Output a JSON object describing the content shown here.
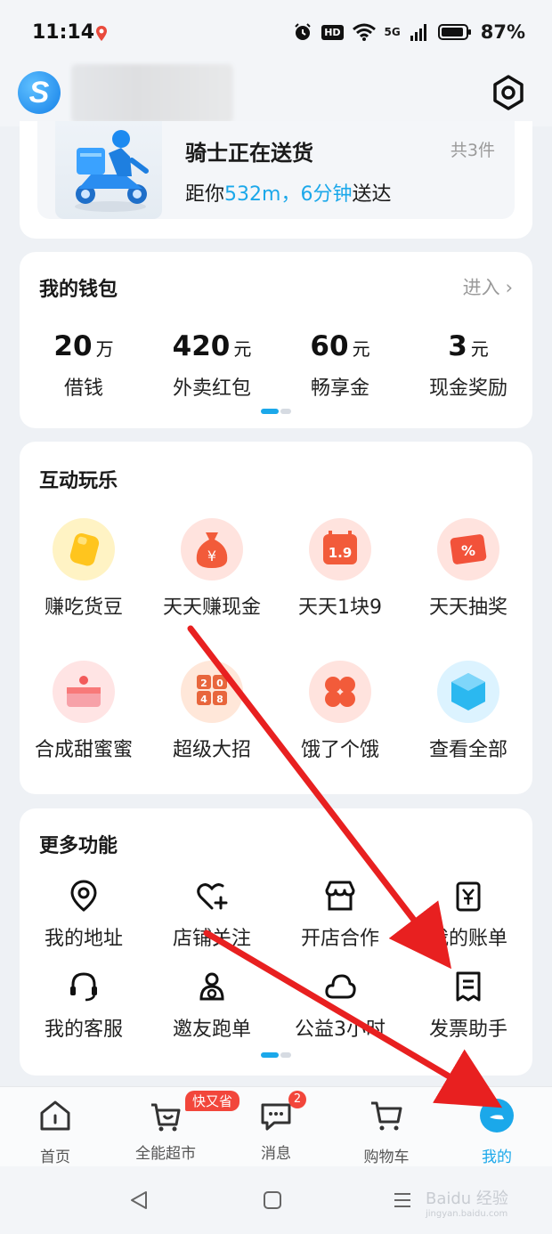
{
  "status_bar": {
    "time": "11:14",
    "battery": "87%",
    "network": "5G",
    "hd": "HD"
  },
  "header": {
    "logo_icon": "app-logo-s",
    "settings_icon": "gear-hex-icon"
  },
  "delivery": {
    "title": "骑士正在送货",
    "count": "共3件",
    "eta_prefix": "距你",
    "eta_distance": "532m，",
    "eta_time": "6分钟",
    "eta_suffix": "送达",
    "accent": "#1ba8ea"
  },
  "wallet": {
    "title": "我的钱包",
    "enter": "进入",
    "items": [
      {
        "value": "20",
        "unit": "万",
        "label": "借钱"
      },
      {
        "value": "420",
        "unit": "元",
        "label": "外卖红包"
      },
      {
        "value": "60",
        "unit": "元",
        "label": "畅享金"
      },
      {
        "value": "3",
        "unit": "元",
        "label": "现金奖励"
      }
    ]
  },
  "play": {
    "title": "互动玩乐",
    "items": [
      {
        "label": "赚吃货豆",
        "icon": "bean-icon",
        "bg": "#fff3c4",
        "color": "#ffc51e"
      },
      {
        "label": "天天赚现金",
        "icon": "money-bag-icon",
        "bg": "#ffe3de",
        "color": "#f25b3a"
      },
      {
        "label": "天天1块9",
        "icon": "calendar-1-9-icon",
        "bg": "#ffe3de",
        "color": "#f25b3a"
      },
      {
        "label": "天天抽奖",
        "icon": "coupon-percent-icon",
        "bg": "#ffe3de",
        "color": "#f2523a"
      },
      {
        "label": "合成甜蜜蜜",
        "icon": "cake-icon",
        "bg": "#ffe4e4",
        "color": "#f87979"
      },
      {
        "label": "超级大招",
        "icon": "2048-tiles-icon",
        "bg": "#ffe7d9",
        "color": "#e8663c"
      },
      {
        "label": "饿了个饿",
        "icon": "clover-icon",
        "bg": "#ffe3de",
        "color": "#f25b3a"
      },
      {
        "label": "查看全部",
        "icon": "cube-icon",
        "bg": "#dcf3ff",
        "color": "#2bb8f0"
      }
    ]
  },
  "more": {
    "title": "更多功能",
    "items": [
      {
        "label": "我的地址",
        "icon": "location-pin-icon"
      },
      {
        "label": "店铺关注",
        "icon": "heart-plus-icon"
      },
      {
        "label": "开店合作",
        "icon": "store-icon"
      },
      {
        "label": "我的账单",
        "icon": "bill-yen-icon"
      },
      {
        "label": "我的客服",
        "icon": "headset-icon"
      },
      {
        "label": "邀友跑单",
        "icon": "friends-icon"
      },
      {
        "label": "公益3小时",
        "icon": "cloud-heart-icon"
      },
      {
        "label": "发票助手",
        "icon": "invoice-icon"
      }
    ]
  },
  "bottom_nav": {
    "items": [
      {
        "label": "首页",
        "icon": "home-icon"
      },
      {
        "label": "全能超市",
        "icon": "basket-icon",
        "badge": "快又省"
      },
      {
        "label": "消息",
        "icon": "message-icon",
        "badge": "2"
      },
      {
        "label": "购物车",
        "icon": "cart-icon"
      },
      {
        "label": "我的",
        "icon": "profile-icon",
        "active": true
      }
    ]
  },
  "watermark": "Baidu 经验",
  "watermark_sub": "jingyan.baidu.com"
}
